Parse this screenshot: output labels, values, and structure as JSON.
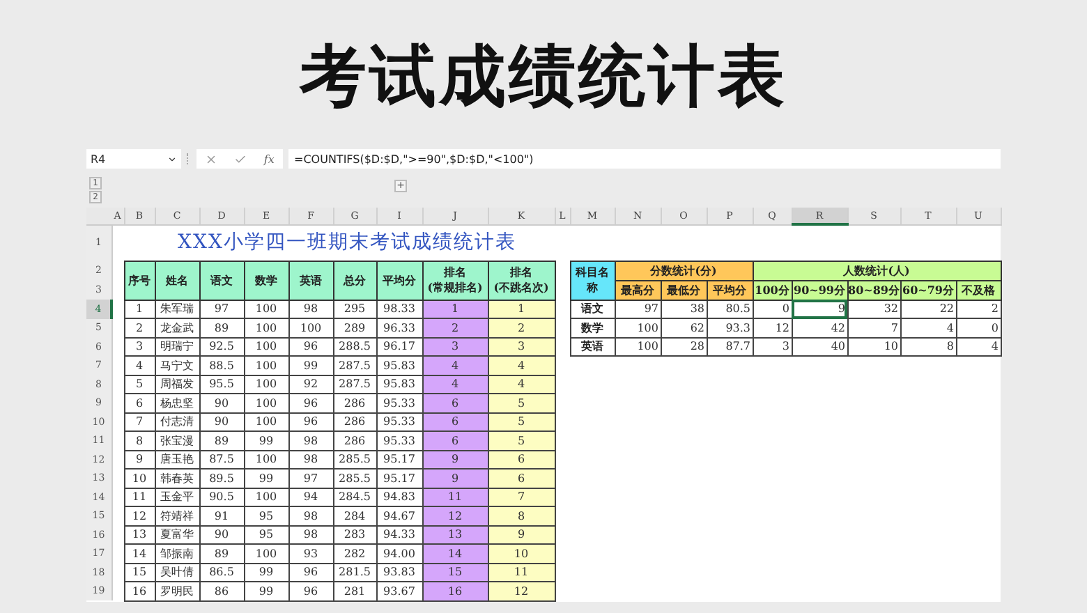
{
  "title": "考试成绩统计表",
  "formula_bar": {
    "cell_ref": "R4",
    "function_label": "fx",
    "formula": "=COUNTIFS($D:$D,\">=90\",$D:$D,\"<100\")"
  },
  "outline": {
    "levels": [
      "1",
      "2"
    ],
    "expand_button": "+"
  },
  "columns": [
    {
      "label": "A",
      "selected": false
    },
    {
      "label": "B",
      "selected": false
    },
    {
      "label": "C",
      "selected": false
    },
    {
      "label": "D",
      "selected": false
    },
    {
      "label": "E",
      "selected": false
    },
    {
      "label": "F",
      "selected": false
    },
    {
      "label": "G",
      "selected": false
    },
    {
      "label": "I",
      "selected": false
    },
    {
      "label": "J",
      "selected": false
    },
    {
      "label": "K",
      "selected": false
    },
    {
      "label": "L",
      "selected": false
    },
    {
      "label": "M",
      "selected": false
    },
    {
      "label": "N",
      "selected": false
    },
    {
      "label": "O",
      "selected": false
    },
    {
      "label": "P",
      "selected": false
    },
    {
      "label": "Q",
      "selected": false
    },
    {
      "label": "R",
      "selected": true
    },
    {
      "label": "S",
      "selected": false
    },
    {
      "label": "T",
      "selected": false
    },
    {
      "label": "U",
      "selected": false
    }
  ],
  "row_numbers": [
    {
      "label": "1",
      "selected": false
    },
    {
      "label": "2",
      "selected": false
    },
    {
      "label": "3",
      "selected": false
    },
    {
      "label": "4",
      "selected": true
    },
    {
      "label": "5",
      "selected": false
    },
    {
      "label": "6",
      "selected": false
    },
    {
      "label": "7",
      "selected": false
    },
    {
      "label": "8",
      "selected": false
    },
    {
      "label": "9",
      "selected": false
    },
    {
      "label": "10",
      "selected": false
    },
    {
      "label": "11",
      "selected": false
    },
    {
      "label": "12",
      "selected": false
    },
    {
      "label": "13",
      "selected": false
    },
    {
      "label": "14",
      "selected": false
    },
    {
      "label": "15",
      "selected": false
    },
    {
      "label": "16",
      "selected": false
    },
    {
      "label": "17",
      "selected": false
    },
    {
      "label": "18",
      "selected": false
    },
    {
      "label": "19",
      "selected": false
    }
  ],
  "score_table": {
    "title": "XXX小学四一班期末考试成绩统计表",
    "columns": [
      {
        "label": "序号",
        "kind": "plain"
      },
      {
        "label": "姓名",
        "kind": "plain"
      },
      {
        "label": "语文",
        "kind": "plain"
      },
      {
        "label": "数学",
        "kind": "plain"
      },
      {
        "label": "英语",
        "kind": "plain"
      },
      {
        "label": "总分",
        "kind": "plain"
      },
      {
        "label": "平均分",
        "kind": "plain"
      },
      {
        "label": "排名",
        "sublabel": "(常规排名)",
        "kind": "rank_regular"
      },
      {
        "label": "排名",
        "sublabel": "(不跳名次)",
        "kind": "rank_dense"
      }
    ],
    "rows": [
      [
        "1",
        "朱军瑞",
        "97",
        "100",
        "98",
        "295",
        "98.33",
        "1",
        "1"
      ],
      [
        "2",
        "龙金武",
        "89",
        "100",
        "100",
        "289",
        "96.33",
        "2",
        "2"
      ],
      [
        "3",
        "明瑞宁",
        "92.5",
        "100",
        "96",
        "288.5",
        "96.17",
        "3",
        "3"
      ],
      [
        "4",
        "马宁文",
        "88.5",
        "100",
        "99",
        "287.5",
        "95.83",
        "4",
        "4"
      ],
      [
        "5",
        "周福发",
        "95.5",
        "100",
        "92",
        "287.5",
        "95.83",
        "4",
        "4"
      ],
      [
        "6",
        "杨忠坚",
        "90",
        "100",
        "96",
        "286",
        "95.33",
        "6",
        "5"
      ],
      [
        "7",
        "付志清",
        "90",
        "100",
        "96",
        "286",
        "95.33",
        "6",
        "5"
      ],
      [
        "8",
        "张宝漫",
        "89",
        "99",
        "98",
        "286",
        "95.33",
        "6",
        "5"
      ],
      [
        "9",
        "唐玉艳",
        "87.5",
        "100",
        "98",
        "285.5",
        "95.17",
        "9",
        "6"
      ],
      [
        "10",
        "韩春英",
        "89.5",
        "99",
        "97",
        "285.5",
        "95.17",
        "9",
        "6"
      ],
      [
        "11",
        "玉金平",
        "90.5",
        "100",
        "94",
        "284.5",
        "94.83",
        "11",
        "7"
      ],
      [
        "12",
        "符靖祥",
        "91",
        "95",
        "98",
        "284",
        "94.67",
        "12",
        "8"
      ],
      [
        "13",
        "夏富华",
        "90",
        "95",
        "98",
        "283",
        "94.33",
        "13",
        "9"
      ],
      [
        "14",
        "邹振南",
        "89",
        "100",
        "93",
        "282",
        "94.00",
        "14",
        "10"
      ],
      [
        "15",
        "吴叶倩",
        "86.5",
        "99",
        "96",
        "281.5",
        "93.83",
        "15",
        "11"
      ],
      [
        "16",
        "罗明民",
        "86",
        "99",
        "96",
        "281",
        "93.67",
        "16",
        "12"
      ]
    ]
  },
  "stats_table": {
    "subject_header": "科目名称",
    "groups": [
      {
        "label": "分数统计(分)",
        "kind": "score",
        "columns": [
          "最高分",
          "最低分",
          "平均分"
        ]
      },
      {
        "label": "人数统计(人)",
        "kind": "count",
        "columns": [
          "100分",
          "90~99分",
          "80~89分",
          "60~79分",
          "不及格"
        ]
      }
    ],
    "rows": [
      {
        "subject": "语文",
        "cells": [
          {
            "text": "97",
            "selected": false
          },
          {
            "text": "38",
            "selected": false
          },
          {
            "text": "80.5",
            "selected": false
          },
          {
            "text": "0",
            "selected": false
          },
          {
            "text": "9",
            "selected": true
          },
          {
            "text": "32",
            "selected": false
          },
          {
            "text": "22",
            "selected": false
          },
          {
            "text": "2",
            "selected": false
          }
        ]
      },
      {
        "subject": "数学",
        "cells": [
          {
            "text": "100",
            "selected": false
          },
          {
            "text": "62",
            "selected": false
          },
          {
            "text": "93.3",
            "selected": false
          },
          {
            "text": "12",
            "selected": false
          },
          {
            "text": "42",
            "selected": false
          },
          {
            "text": "7",
            "selected": false
          },
          {
            "text": "4",
            "selected": false
          },
          {
            "text": "0",
            "selected": false
          }
        ]
      },
      {
        "subject": "英语",
        "cells": [
          {
            "text": "100",
            "selected": false
          },
          {
            "text": "28",
            "selected": false
          },
          {
            "text": "87.7",
            "selected": false
          },
          {
            "text": "3",
            "selected": false
          },
          {
            "text": "40",
            "selected": false
          },
          {
            "text": "10",
            "selected": false
          },
          {
            "text": "8",
            "selected": false
          },
          {
            "text": "4",
            "selected": false
          }
        ]
      }
    ]
  }
}
